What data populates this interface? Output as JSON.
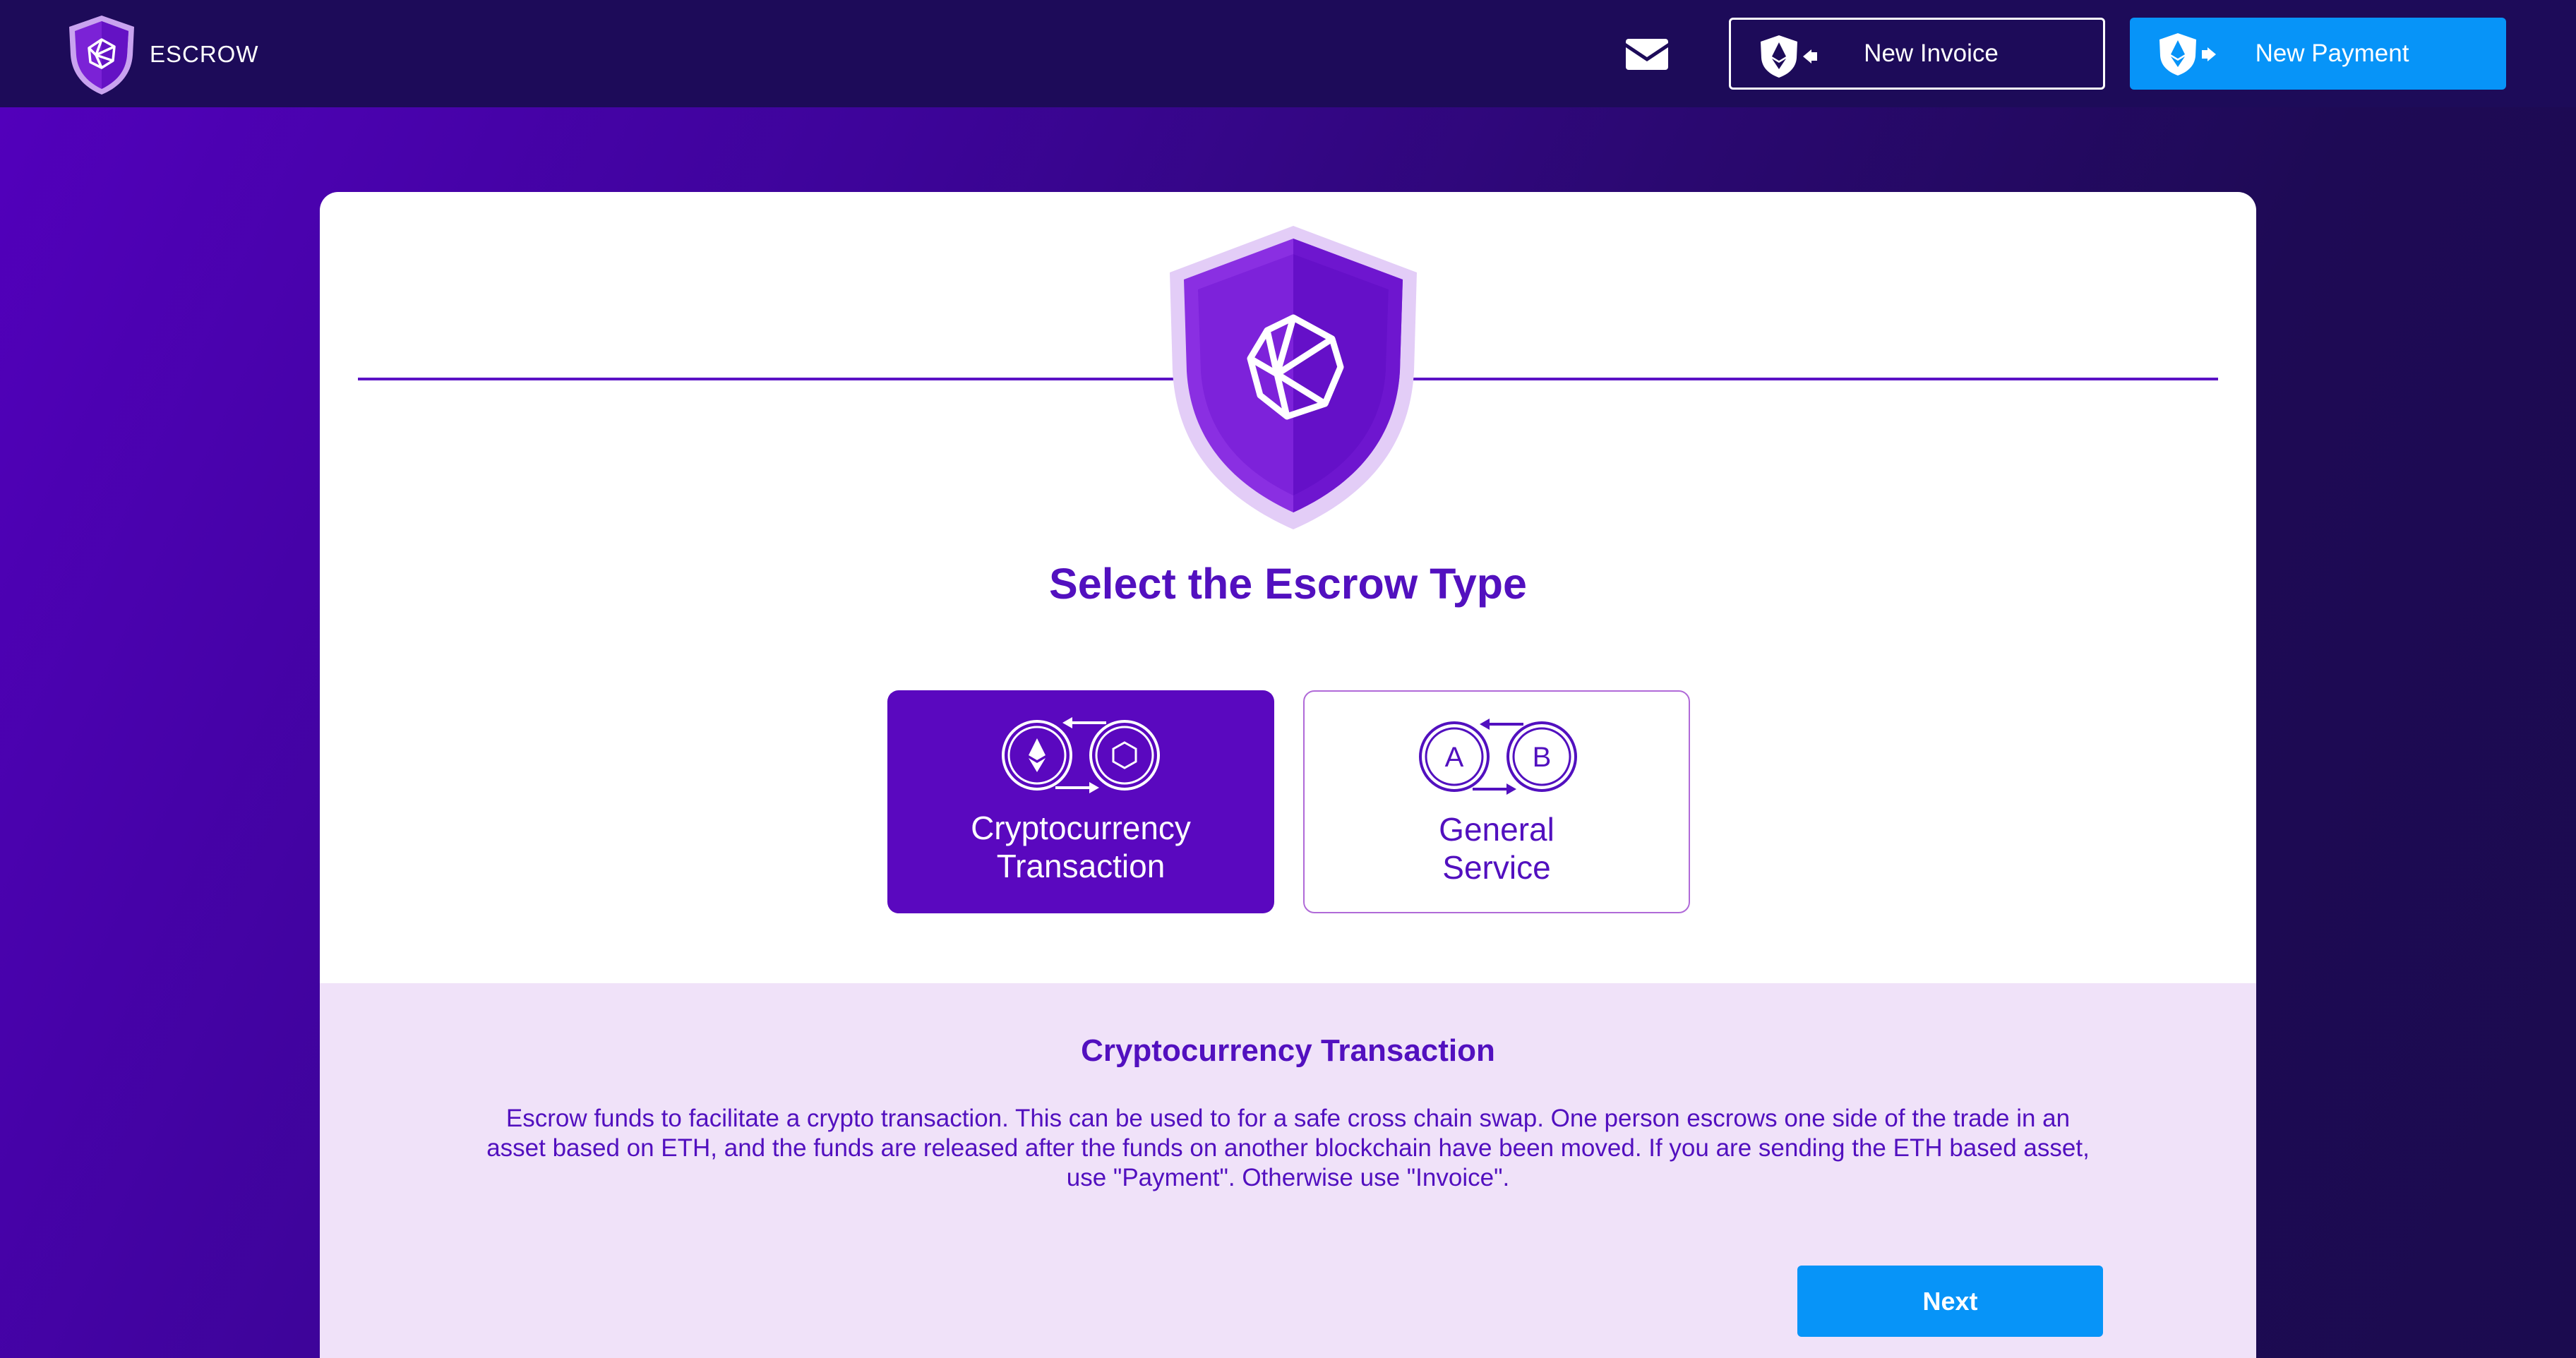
{
  "header": {
    "brand_name": "ESCROW",
    "new_invoice_label": "New Invoice",
    "new_payment_label": "New Payment"
  },
  "main": {
    "title": "Select the Escrow Type",
    "types": [
      {
        "label_line1": "Cryptocurrency",
        "label_line2": "Transaction",
        "selected": true
      },
      {
        "label_line1": "General",
        "label_line2": "Service",
        "selected": false
      }
    ],
    "general_service_icon_letters": [
      "A",
      "B"
    ]
  },
  "description": {
    "title": "Cryptocurrency Transaction",
    "line1": "Escrow funds to facilitate a crypto transaction. This can be used to for a safe cross chain swap. One person escrows one side of the trade in an",
    "line2": "asset based on ETH, and the funds are released after the funds on another blockchain have been moved. If you are sending the ETH based asset,",
    "line3": "use \"Payment\". Otherwise use \"Invoice\".",
    "next_label": "Next"
  },
  "colors": {
    "header_bg": "#1d0b59",
    "primary_purple": "#5210bf",
    "accent_blue": "#0794f8",
    "section_lavender": "#f0e2f9"
  },
  "icons": {
    "brand": "shield-logo-icon",
    "mail": "envelope-icon",
    "invoice": "eth-shield-arrow-left-icon",
    "payment": "eth-shield-arrow-right-icon",
    "crypto": "eth-swap-icon",
    "general": "ab-swap-icon"
  }
}
